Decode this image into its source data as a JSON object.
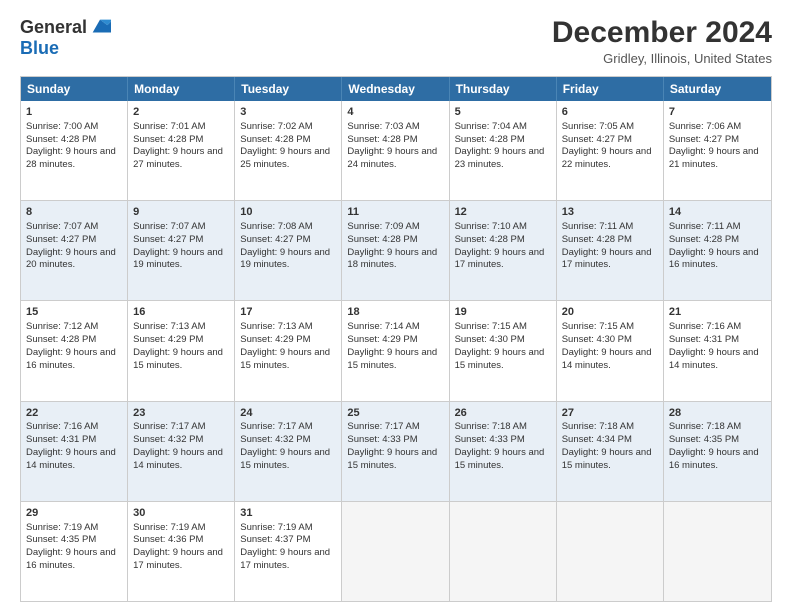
{
  "logo": {
    "general": "General",
    "blue": "Blue"
  },
  "title": "December 2024",
  "location": "Gridley, Illinois, United States",
  "days": [
    "Sunday",
    "Monday",
    "Tuesday",
    "Wednesday",
    "Thursday",
    "Friday",
    "Saturday"
  ],
  "weeks": [
    [
      {
        "day": "1",
        "sunrise": "Sunrise: 7:00 AM",
        "sunset": "Sunset: 4:28 PM",
        "daylight": "Daylight: 9 hours and 28 minutes."
      },
      {
        "day": "2",
        "sunrise": "Sunrise: 7:01 AM",
        "sunset": "Sunset: 4:28 PM",
        "daylight": "Daylight: 9 hours and 27 minutes."
      },
      {
        "day": "3",
        "sunrise": "Sunrise: 7:02 AM",
        "sunset": "Sunset: 4:28 PM",
        "daylight": "Daylight: 9 hours and 25 minutes."
      },
      {
        "day": "4",
        "sunrise": "Sunrise: 7:03 AM",
        "sunset": "Sunset: 4:28 PM",
        "daylight": "Daylight: 9 hours and 24 minutes."
      },
      {
        "day": "5",
        "sunrise": "Sunrise: 7:04 AM",
        "sunset": "Sunset: 4:28 PM",
        "daylight": "Daylight: 9 hours and 23 minutes."
      },
      {
        "day": "6",
        "sunrise": "Sunrise: 7:05 AM",
        "sunset": "Sunset: 4:27 PM",
        "daylight": "Daylight: 9 hours and 22 minutes."
      },
      {
        "day": "7",
        "sunrise": "Sunrise: 7:06 AM",
        "sunset": "Sunset: 4:27 PM",
        "daylight": "Daylight: 9 hours and 21 minutes."
      }
    ],
    [
      {
        "day": "8",
        "sunrise": "Sunrise: 7:07 AM",
        "sunset": "Sunset: 4:27 PM",
        "daylight": "Daylight: 9 hours and 20 minutes."
      },
      {
        "day": "9",
        "sunrise": "Sunrise: 7:07 AM",
        "sunset": "Sunset: 4:27 PM",
        "daylight": "Daylight: 9 hours and 19 minutes."
      },
      {
        "day": "10",
        "sunrise": "Sunrise: 7:08 AM",
        "sunset": "Sunset: 4:27 PM",
        "daylight": "Daylight: 9 hours and 19 minutes."
      },
      {
        "day": "11",
        "sunrise": "Sunrise: 7:09 AM",
        "sunset": "Sunset: 4:28 PM",
        "daylight": "Daylight: 9 hours and 18 minutes."
      },
      {
        "day": "12",
        "sunrise": "Sunrise: 7:10 AM",
        "sunset": "Sunset: 4:28 PM",
        "daylight": "Daylight: 9 hours and 17 minutes."
      },
      {
        "day": "13",
        "sunrise": "Sunrise: 7:11 AM",
        "sunset": "Sunset: 4:28 PM",
        "daylight": "Daylight: 9 hours and 17 minutes."
      },
      {
        "day": "14",
        "sunrise": "Sunrise: 7:11 AM",
        "sunset": "Sunset: 4:28 PM",
        "daylight": "Daylight: 9 hours and 16 minutes."
      }
    ],
    [
      {
        "day": "15",
        "sunrise": "Sunrise: 7:12 AM",
        "sunset": "Sunset: 4:28 PM",
        "daylight": "Daylight: 9 hours and 16 minutes."
      },
      {
        "day": "16",
        "sunrise": "Sunrise: 7:13 AM",
        "sunset": "Sunset: 4:29 PM",
        "daylight": "Daylight: 9 hours and 15 minutes."
      },
      {
        "day": "17",
        "sunrise": "Sunrise: 7:13 AM",
        "sunset": "Sunset: 4:29 PM",
        "daylight": "Daylight: 9 hours and 15 minutes."
      },
      {
        "day": "18",
        "sunrise": "Sunrise: 7:14 AM",
        "sunset": "Sunset: 4:29 PM",
        "daylight": "Daylight: 9 hours and 15 minutes."
      },
      {
        "day": "19",
        "sunrise": "Sunrise: 7:15 AM",
        "sunset": "Sunset: 4:30 PM",
        "daylight": "Daylight: 9 hours and 15 minutes."
      },
      {
        "day": "20",
        "sunrise": "Sunrise: 7:15 AM",
        "sunset": "Sunset: 4:30 PM",
        "daylight": "Daylight: 9 hours and 14 minutes."
      },
      {
        "day": "21",
        "sunrise": "Sunrise: 7:16 AM",
        "sunset": "Sunset: 4:31 PM",
        "daylight": "Daylight: 9 hours and 14 minutes."
      }
    ],
    [
      {
        "day": "22",
        "sunrise": "Sunrise: 7:16 AM",
        "sunset": "Sunset: 4:31 PM",
        "daylight": "Daylight: 9 hours and 14 minutes."
      },
      {
        "day": "23",
        "sunrise": "Sunrise: 7:17 AM",
        "sunset": "Sunset: 4:32 PM",
        "daylight": "Daylight: 9 hours and 14 minutes."
      },
      {
        "day": "24",
        "sunrise": "Sunrise: 7:17 AM",
        "sunset": "Sunset: 4:32 PM",
        "daylight": "Daylight: 9 hours and 15 minutes."
      },
      {
        "day": "25",
        "sunrise": "Sunrise: 7:17 AM",
        "sunset": "Sunset: 4:33 PM",
        "daylight": "Daylight: 9 hours and 15 minutes."
      },
      {
        "day": "26",
        "sunrise": "Sunrise: 7:18 AM",
        "sunset": "Sunset: 4:33 PM",
        "daylight": "Daylight: 9 hours and 15 minutes."
      },
      {
        "day": "27",
        "sunrise": "Sunrise: 7:18 AM",
        "sunset": "Sunset: 4:34 PM",
        "daylight": "Daylight: 9 hours and 15 minutes."
      },
      {
        "day": "28",
        "sunrise": "Sunrise: 7:18 AM",
        "sunset": "Sunset: 4:35 PM",
        "daylight": "Daylight: 9 hours and 16 minutes."
      }
    ],
    [
      {
        "day": "29",
        "sunrise": "Sunrise: 7:19 AM",
        "sunset": "Sunset: 4:35 PM",
        "daylight": "Daylight: 9 hours and 16 minutes."
      },
      {
        "day": "30",
        "sunrise": "Sunrise: 7:19 AM",
        "sunset": "Sunset: 4:36 PM",
        "daylight": "Daylight: 9 hours and 17 minutes."
      },
      {
        "day": "31",
        "sunrise": "Sunrise: 7:19 AM",
        "sunset": "Sunset: 4:37 PM",
        "daylight": "Daylight: 9 hours and 17 minutes."
      },
      null,
      null,
      null,
      null
    ]
  ]
}
